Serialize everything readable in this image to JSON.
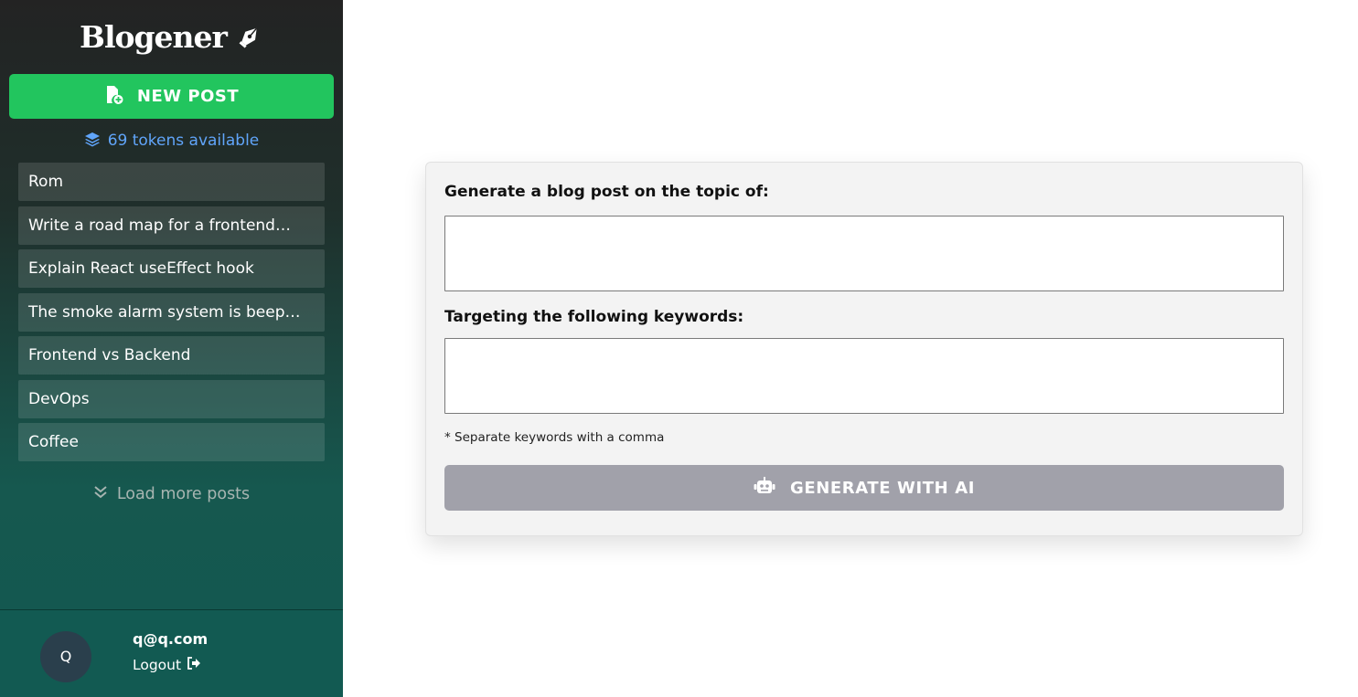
{
  "sidebar": {
    "brand": "Blogener",
    "brand_icon": "pen-nib-icon",
    "new_post_label": "NEW POST",
    "tokens_label": "69 tokens available",
    "posts": [
      "Rom",
      "Write a road map for a frontend…",
      "Explain React useEffect hook",
      "The smoke alarm system is beep…",
      "Frontend vs Backend",
      "DevOps",
      "Coffee"
    ],
    "load_more_label": "Load more posts",
    "user": {
      "avatar_initial": "Q",
      "email": "q@q.com",
      "logout_label": "Logout"
    }
  },
  "form": {
    "topic_label": "Generate a blog post on the topic of:",
    "topic_value": "",
    "keywords_label": "Targeting the following keywords:",
    "keywords_value": "",
    "hint": "* Separate keywords with a comma",
    "generate_label": "GENERATE WITH AI"
  },
  "colors": {
    "accent_green": "#22c55e",
    "tokens_blue": "#60a5fa",
    "disabled_button": "#a1a1aa"
  }
}
